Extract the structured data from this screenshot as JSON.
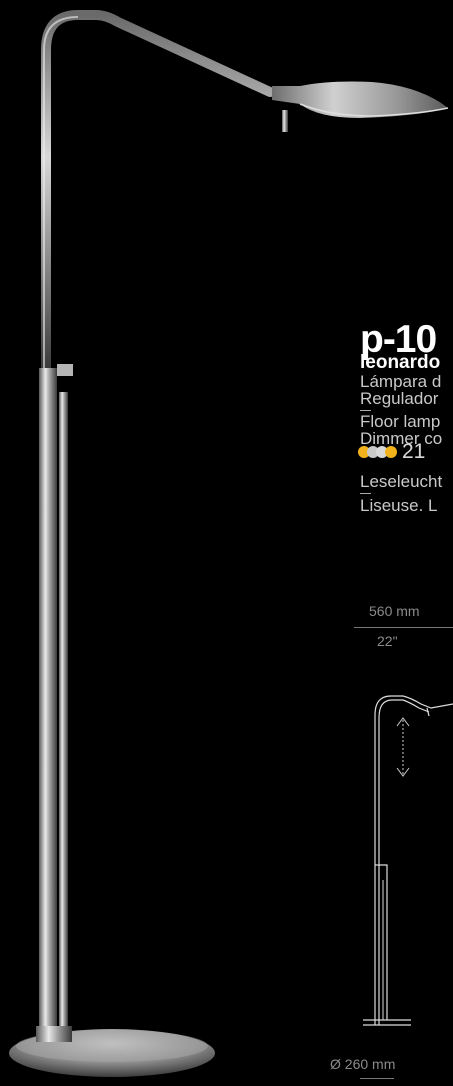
{
  "product": {
    "title": "p-10",
    "subtitle": "leonardo",
    "descriptions": [
      {
        "text": "Lámpara d"
      },
      {
        "text": "Regulador"
      },
      {
        "text": "Floor lamp"
      },
      {
        "text": "Dimmer co"
      },
      {
        "text": "Leseleucht"
      },
      {
        "text": "Liseuse. L"
      }
    ],
    "finish_colors": [
      "#f2b21c",
      "#c9c9c9",
      "#d8d8d8",
      "#f2b21c"
    ],
    "code": "21"
  },
  "dimensions": {
    "width_mm": "560 mm",
    "width_in": "22\"",
    "base_diameter": "Ø 260 mm"
  }
}
